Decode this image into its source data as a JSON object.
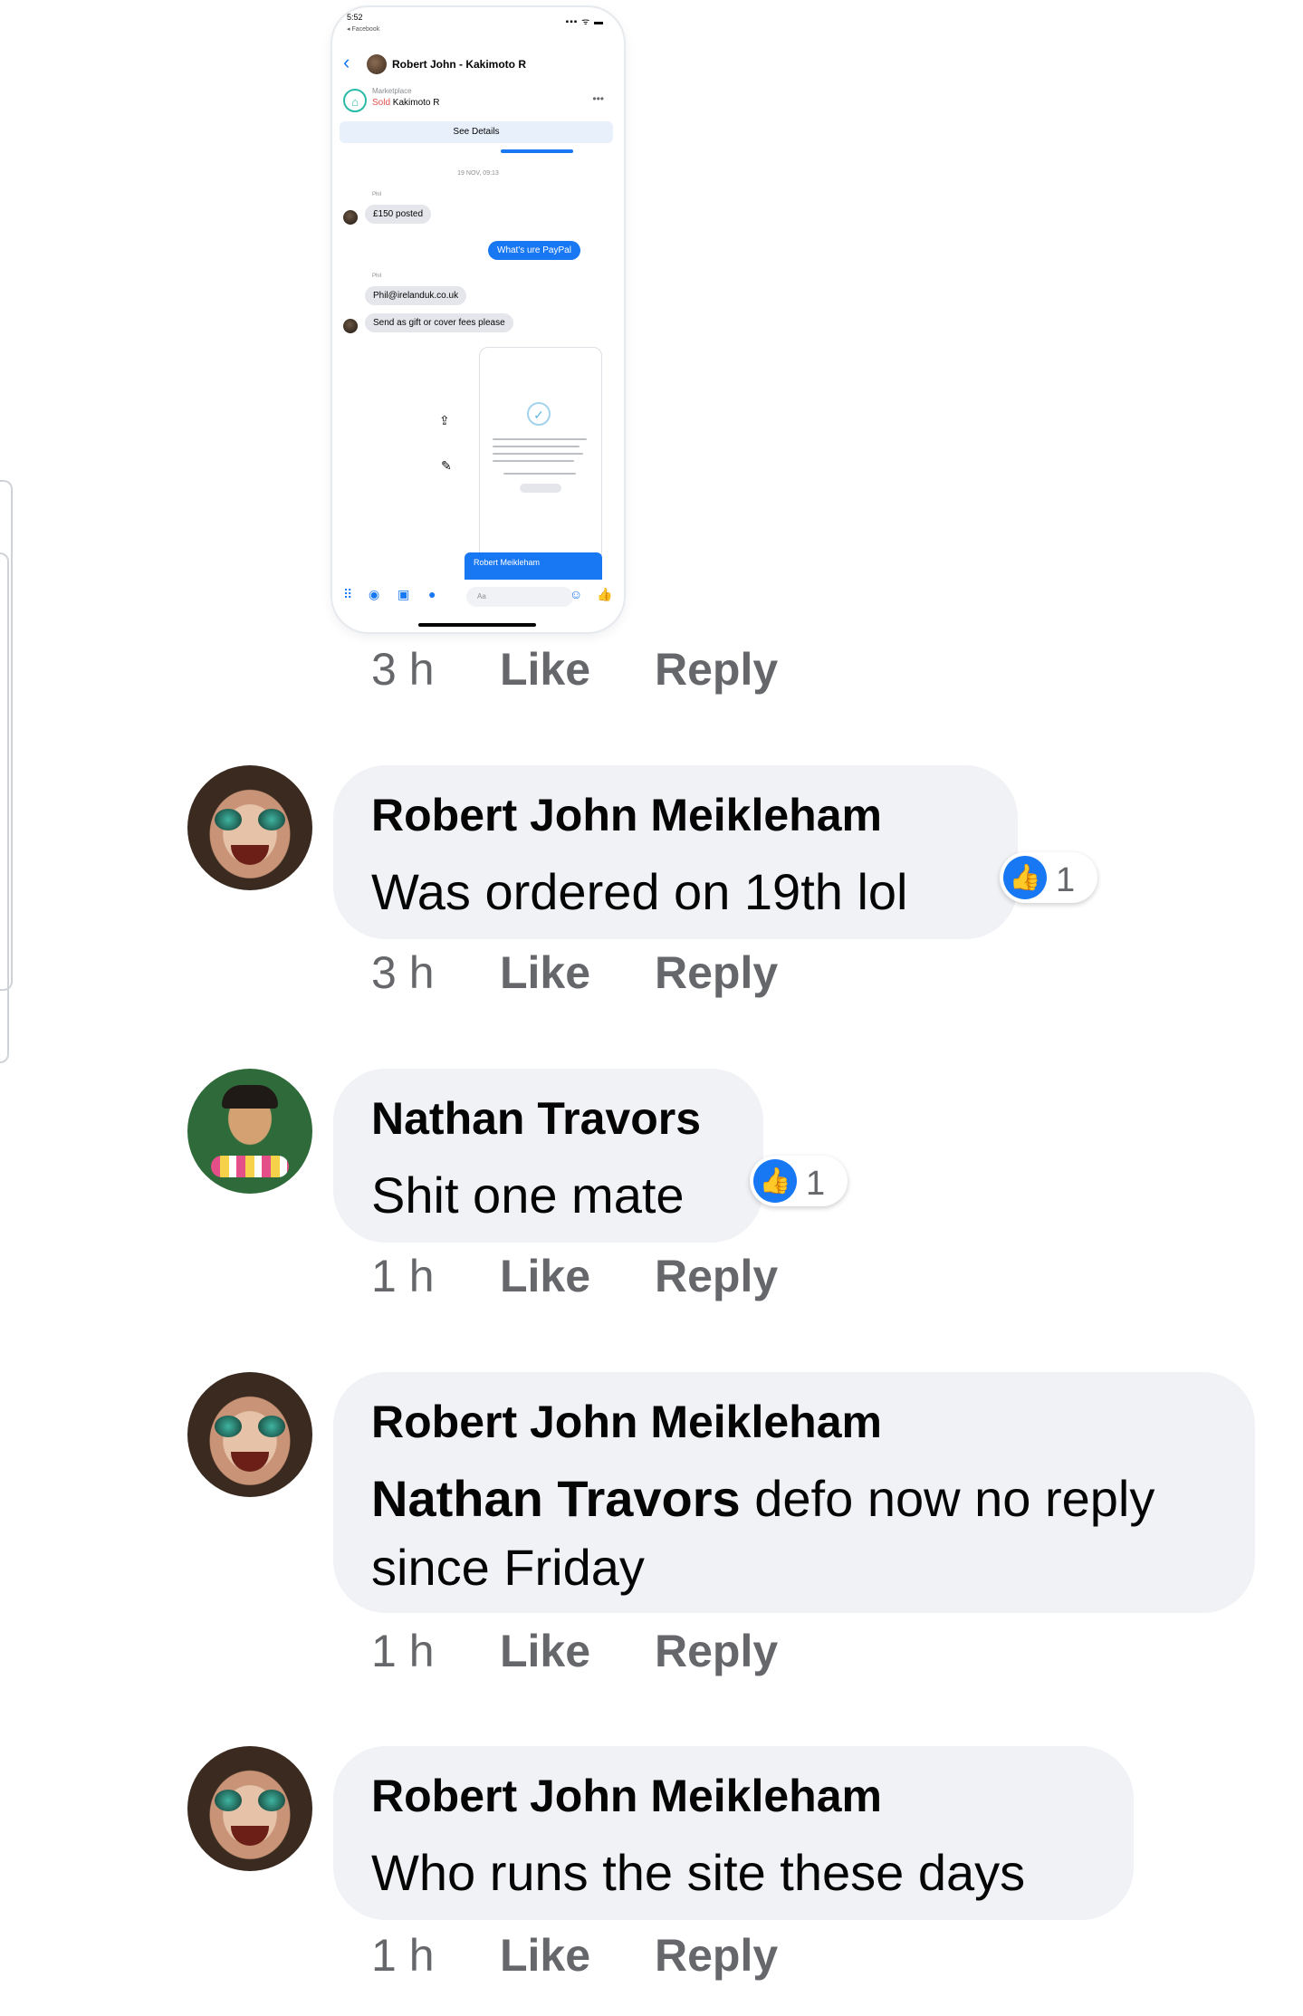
{
  "screenshot": {
    "status_time": "5:52",
    "status_back": "◂ Facebook",
    "signal": "▪▪▪ ᯤ ▬",
    "header_title": "Robert John - Kakimoto R",
    "marketplace_label": "Marketplace",
    "sold_prefix": "Sold",
    "sold_item": "Kakimoto R",
    "see_details": "See Details",
    "timestamp": "19 NOV, 09:13",
    "sender_label": "Phil",
    "msg_posted": "£150 posted",
    "msg_paypal": "What's ure PayPal",
    "msg_email": "Phil@irelanduk.co.uk",
    "msg_gift": "Send as gift or cover fees please",
    "forward_name": "Robert Meikleham",
    "input_placeholder": "Aa"
  },
  "first_actions": {
    "time": "3 h",
    "like": "Like",
    "reply": "Reply"
  },
  "comments": [
    {
      "name": "Robert John Meikleham",
      "text": "Was ordered on 19th lol",
      "time": "3 h",
      "like": "Like",
      "reply": "Reply",
      "reaction_count": "1"
    },
    {
      "name": "Nathan Travors",
      "text": "Shit one mate",
      "time": "1 h",
      "like": "Like",
      "reply": "Reply",
      "reaction_count": "1"
    },
    {
      "name": "Robert John Meikleham",
      "mention": "Nathan Travors",
      "text_line1": " defo now no reply",
      "text_line2": "since Friday",
      "time": "1 h",
      "like": "Like",
      "reply": "Reply"
    },
    {
      "name": "Robert John Meikleham",
      "text": "Who runs the site these days",
      "time": "1 h",
      "like": "Like",
      "reply": "Reply"
    }
  ],
  "colors": {
    "bubble": "#f0f2f5",
    "accent": "#1877f2",
    "meta": "#65676b"
  },
  "icons": [
    "like-thumb-icon",
    "back-chevron-icon",
    "marketplace-icon",
    "camera-icon",
    "photo-icon",
    "mic-icon"
  ]
}
